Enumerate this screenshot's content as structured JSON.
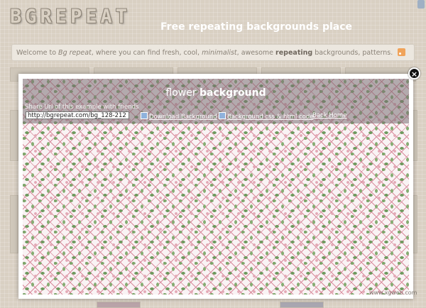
{
  "site": {
    "logo": "BGREPEAT",
    "tagline": "Free repeating backgrounds place"
  },
  "welcome": {
    "prefix": "Welcome to ",
    "brand": "Bg repeat",
    "middle": ", where you can find fresh, cool, ",
    "minimalist": "minimalist",
    "middle2": ", awesome ",
    "repeating": "repeating",
    "suffix": " backgrounds, patterns."
  },
  "icons": {
    "rss": "rss-icon",
    "close": "close-icon",
    "download": "download-icon",
    "code": "code-icon"
  },
  "modal": {
    "title_light": "flower ",
    "title_bold": "background",
    "share_label": "Share Url of this example with friends",
    "share_url": "http://bgrepeat.com/bg_128-212",
    "download_label": "Download Background",
    "css_label": "Background css & html code",
    "back_label": "Back Home",
    "close_symbol": "×"
  },
  "pattern": {
    "name": "flower",
    "colors": {
      "base": "#f9f3f4",
      "lattice": "#d98a9c",
      "leaf": "#6e9a5e",
      "flower": "#e3a9b6"
    }
  },
  "watermark": "www.xgweb.com"
}
